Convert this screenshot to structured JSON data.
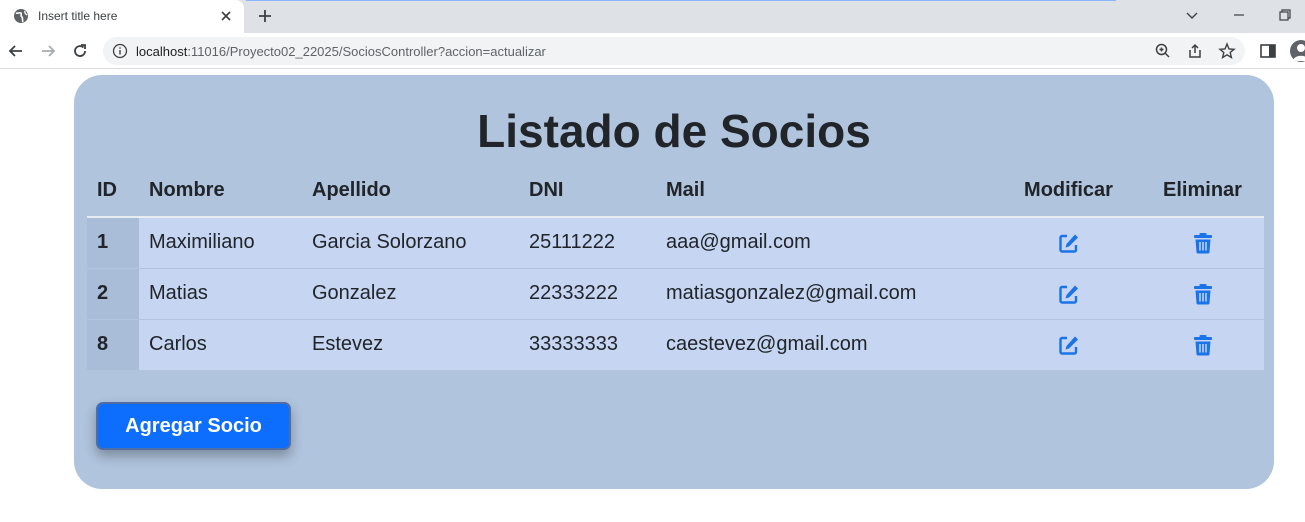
{
  "browser": {
    "tab_title": "Insert title here",
    "url_host": "localhost",
    "url_path": ":11016/Proyecto02_22025/SociosController?accion=actualizar"
  },
  "page": {
    "title": "Listado de Socios",
    "add_button_label": "Agregar Socio"
  },
  "table": {
    "headers": {
      "id": "ID",
      "nombre": "Nombre",
      "apellido": "Apellido",
      "dni": "DNI",
      "mail": "Mail",
      "modificar": "Modificar",
      "eliminar": "Eliminar"
    },
    "rows": [
      {
        "id": "1",
        "nombre": "Maximiliano",
        "apellido": "Garcia Solorzano",
        "dni": "25111222",
        "mail": "aaa@gmail.com"
      },
      {
        "id": "2",
        "nombre": "Matias",
        "apellido": "Gonzalez",
        "dni": "22333222",
        "mail": "matiasgonzalez@gmail.com"
      },
      {
        "id": "8",
        "nombre": "Carlos",
        "apellido": "Estevez",
        "dni": "33333333",
        "mail": "caestevez@gmail.com"
      }
    ]
  },
  "icons": {
    "edit": "edit-icon",
    "delete": "trash-icon"
  },
  "colors": {
    "card_bg": "#b0c4de",
    "row_bg": "#c5d5f2",
    "id_cell_bg": "#a9bcd8",
    "primary": "#0d6efd",
    "icon_blue": "#1a73e8"
  }
}
